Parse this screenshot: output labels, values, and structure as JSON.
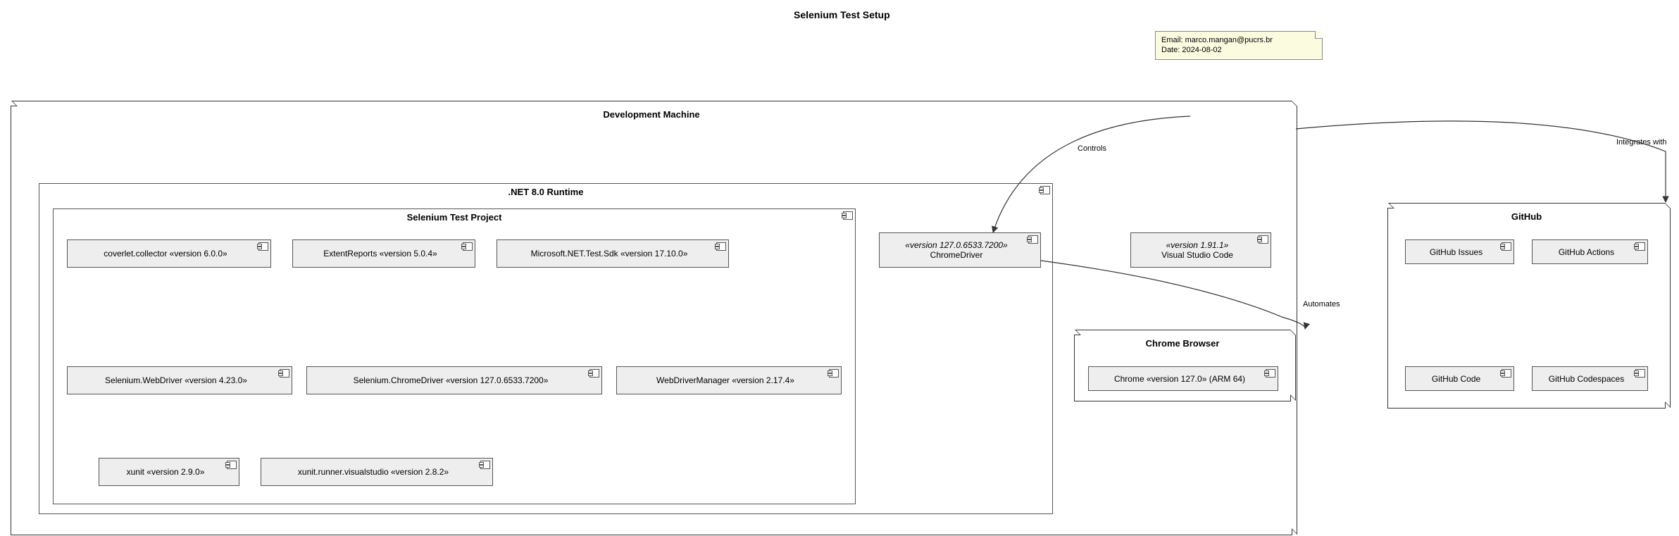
{
  "title": "Selenium Test Setup",
  "note": {
    "email_line": "Email: marco.mangan@pucrs.br",
    "date_line": "Date: 2024-08-02"
  },
  "dev_machine": {
    "title": "Development Machine"
  },
  "dotnet": {
    "title": ".NET 8.0 Runtime"
  },
  "project": {
    "title": "Selenium Test Project"
  },
  "packages": {
    "coverlet": "coverlet.collector «version 6.0.0»",
    "extent": "ExtentReports «version 5.0.4»",
    "mstest": "Microsoft.NET.Test.Sdk «version 17.10.0»",
    "selwd": "Selenium.WebDriver «version 4.23.0»",
    "selcd": "Selenium.ChromeDriver «version 127.0.6533.7200»",
    "wdm": "WebDriverManager «version 2.17.4»",
    "xunit": "xunit «version 2.9.0»",
    "xrunner": "xunit.runner.visualstudio «version 2.8.2»"
  },
  "chromedriver": {
    "meta": "«version 127.0.6533.7200»",
    "name": "ChromeDriver"
  },
  "vscode": {
    "meta": "«version 1.91.1»",
    "name": "Visual Studio Code"
  },
  "chrome_browser": {
    "title": "Chrome Browser"
  },
  "chrome": {
    "name": "Chrome «version 127.0» (ARM 64)"
  },
  "github": {
    "title": "GitHub"
  },
  "gh": {
    "issues": "GitHub Issues",
    "actions": "GitHub Actions",
    "code": "GitHub Code",
    "codespaces": "GitHub Codespaces"
  },
  "edges": {
    "controls": "Controls",
    "automates": "Automates",
    "integrates": "Integrates with"
  }
}
